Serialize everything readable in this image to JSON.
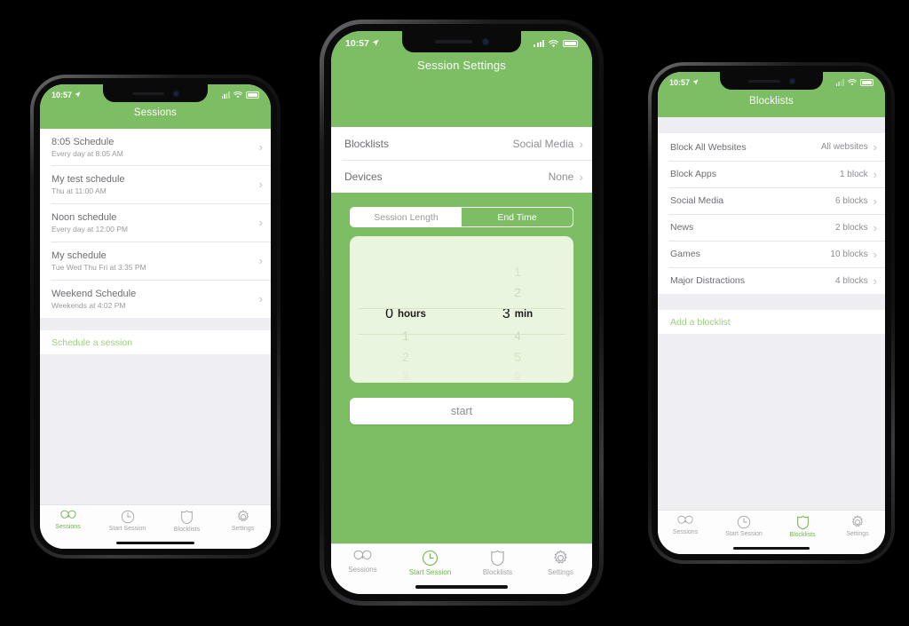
{
  "theme": {
    "green": "#7dbd63",
    "green_dark": "#6fb24f",
    "link_green": "#9dcf7f",
    "picker_bg": "#e9f5de",
    "gray_band": "#eeeef2",
    "text_primary": "#6d6d72",
    "text_secondary": "#9a9a9e"
  },
  "status_bar": {
    "time": "10:57",
    "location_icon": "location-arrow-icon",
    "cellular_icon": "cellular-signal-icon",
    "wifi_icon": "wifi-icon",
    "battery_icon": "battery-icon"
  },
  "tabs": [
    {
      "label": "Sessions",
      "icon": "butterfly-icon"
    },
    {
      "label": "Start Session",
      "icon": "clock-icon"
    },
    {
      "label": "Blocklists",
      "icon": "shield-icon"
    },
    {
      "label": "Settings",
      "icon": "gear-icon"
    }
  ],
  "phone_left": {
    "nav_title": "Sessions",
    "active_tab": 0,
    "sessions": [
      {
        "title": "8:05 Schedule",
        "subtitle": "Every day at 8:05 AM",
        "chevron": "chevron-right-icon"
      },
      {
        "title": "My test schedule",
        "subtitle": "Thu at 11:00 AM",
        "chevron": "chevron-right-icon"
      },
      {
        "title": "Noon schedule",
        "subtitle": "Every day at 12:00 PM",
        "chevron": "chevron-right-icon"
      },
      {
        "title": "My schedule",
        "subtitle": "Tue Wed Thu Fri at 3:35 PM",
        "chevron": "chevron-right-icon"
      },
      {
        "title": "Weekend Schedule",
        "subtitle": "Weekends at 4:02 PM",
        "chevron": "chevron-right-icon"
      }
    ],
    "add_link": "Schedule a session"
  },
  "phone_center": {
    "nav_title": "Session Settings",
    "active_tab": 1,
    "settings_rows": [
      {
        "label": "Blocklists",
        "value": "Social Media",
        "chevron": "chevron-right-icon"
      },
      {
        "label": "Devices",
        "value": "None",
        "chevron": "chevron-right-icon"
      }
    ],
    "segmented": {
      "options": [
        "Session Length",
        "End Time"
      ],
      "selected_index": 0
    },
    "picker": {
      "hours": {
        "above": [
          "",
          ""
        ],
        "selected_value": "0",
        "selected_unit": "hours",
        "below": [
          "1",
          "2",
          "3"
        ]
      },
      "minutes": {
        "above": [
          "1",
          "2"
        ],
        "selected_value": "3",
        "selected_unit": "min",
        "below": [
          "4",
          "5",
          "6"
        ]
      }
    },
    "start_button": "start"
  },
  "phone_right": {
    "nav_title": "Blocklists",
    "active_tab": 2,
    "blocklists": [
      {
        "title": "Block All Websites",
        "value": "All websites",
        "chevron": "chevron-right-icon"
      },
      {
        "title": "Block Apps",
        "value": "1 block",
        "chevron": "chevron-right-icon"
      },
      {
        "title": "Social Media",
        "value": "6 blocks",
        "chevron": "chevron-right-icon"
      },
      {
        "title": "News",
        "value": "2 blocks",
        "chevron": "chevron-right-icon"
      },
      {
        "title": "Games",
        "value": "10 blocks",
        "chevron": "chevron-right-icon"
      },
      {
        "title": "Major Distractions",
        "value": "4 blocks",
        "chevron": "chevron-right-icon"
      }
    ],
    "add_link": "Add a blocklist"
  }
}
